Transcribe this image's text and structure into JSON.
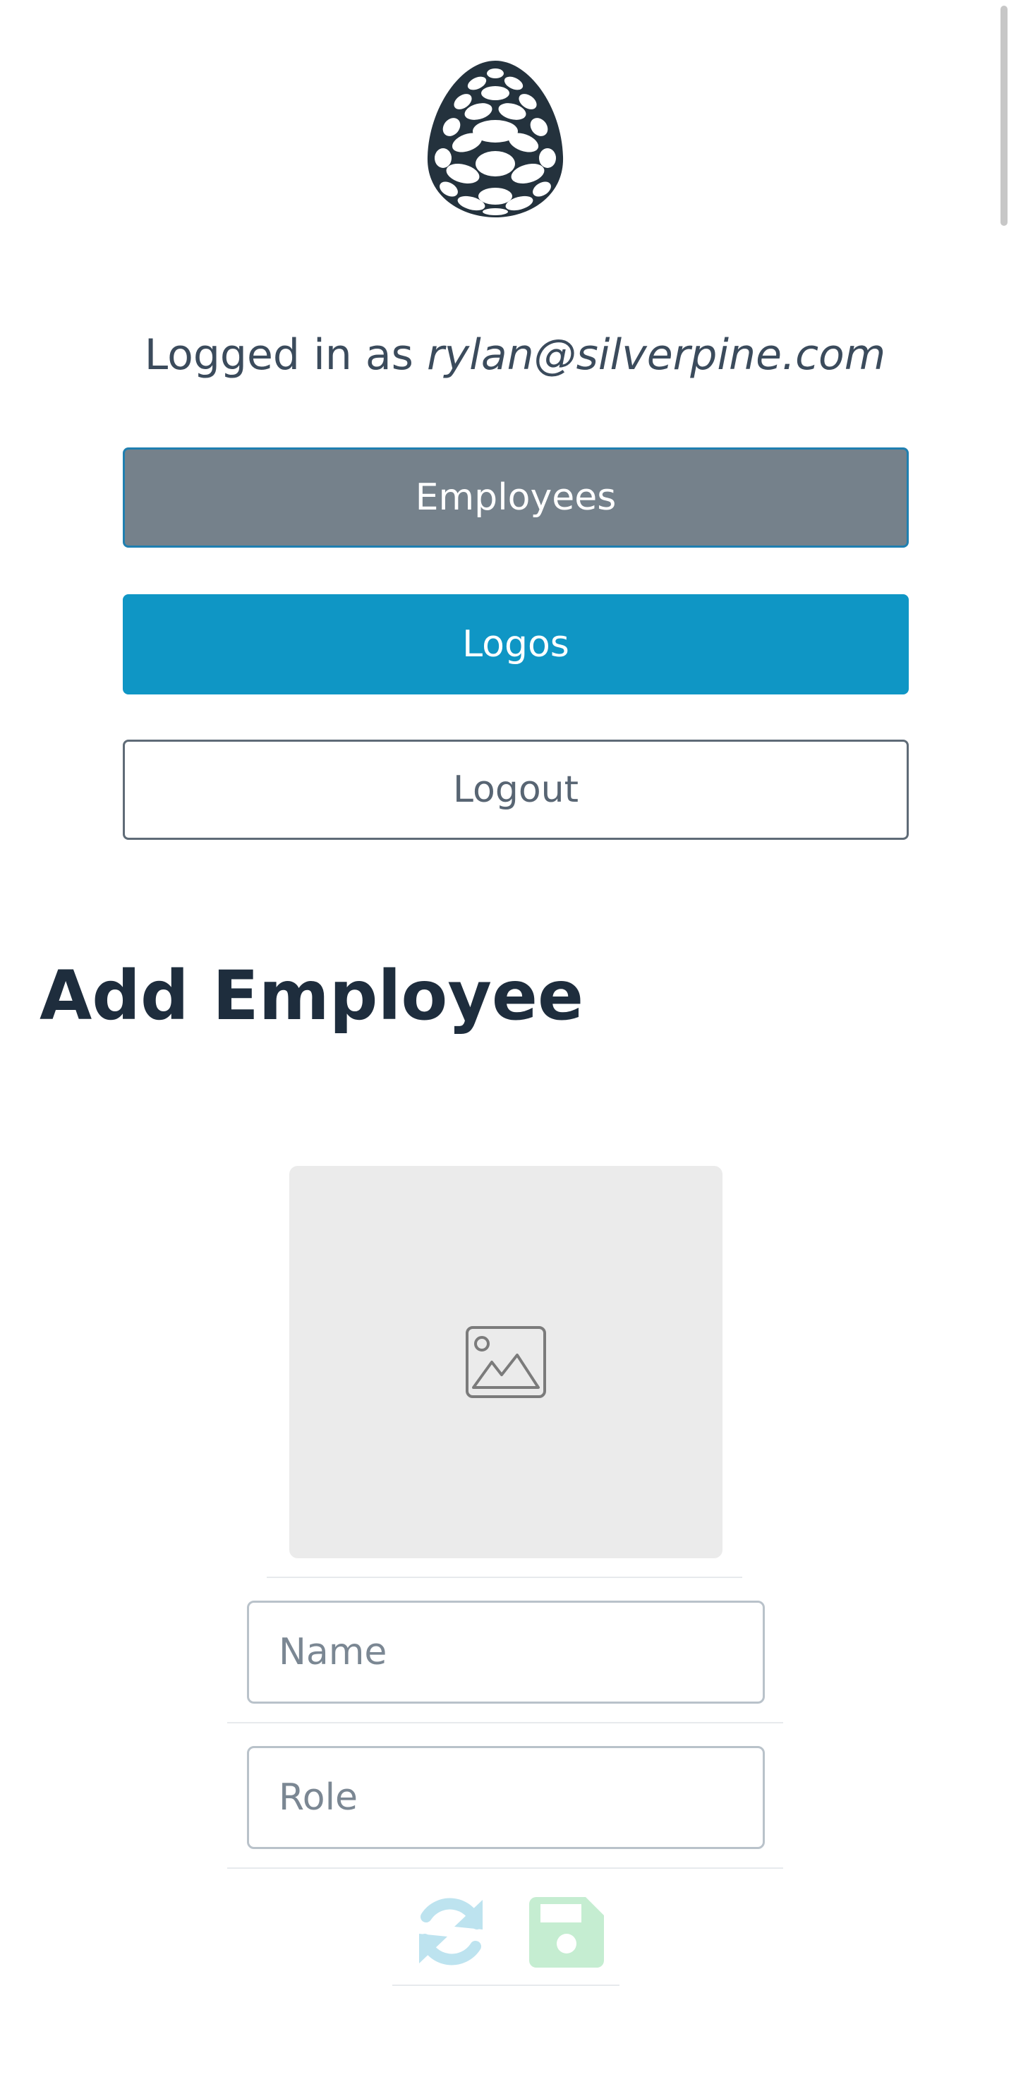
{
  "header": {
    "logo_icon": "pinecone-logo-icon",
    "logged_in_prefix": "Logged in as ",
    "logged_in_email": "rylan@silverpine.com"
  },
  "nav": {
    "employees_label": "Employees",
    "logos_label": "Logos",
    "logout_label": "Logout"
  },
  "form": {
    "title": "Add Employee",
    "image_icon": "image-placeholder-icon",
    "name_placeholder": "Name",
    "name_value": "",
    "role_placeholder": "Role",
    "role_value": "",
    "reset_icon": "refresh-icon",
    "save_icon": "save-icon"
  },
  "colors": {
    "employees_button": "#75818b",
    "logos_button": "#0f96c5",
    "refresh_icon": "#bde3ef",
    "save_icon": "#c5edd1"
  }
}
